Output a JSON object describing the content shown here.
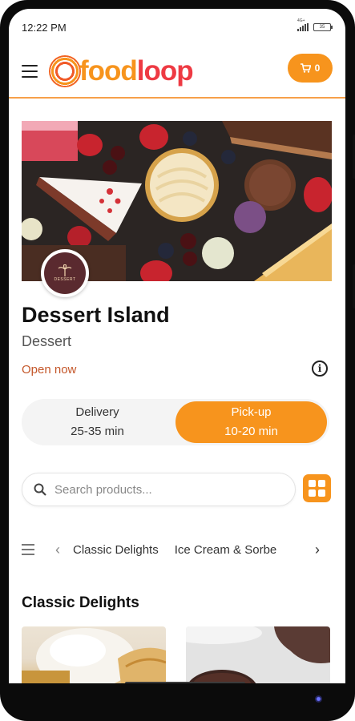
{
  "status_bar": {
    "time": "12:22 PM",
    "network": "4G+",
    "battery": "35"
  },
  "header": {
    "logo_prefix": "food",
    "logo_suffix": "loop",
    "cart_count": "0"
  },
  "store": {
    "logo_text": "DESSERT",
    "name": "Dessert Island",
    "category": "Dessert",
    "status": "Open now"
  },
  "fulfillment": {
    "options": [
      {
        "label": "Delivery",
        "time": "25-35 min",
        "selected": false
      },
      {
        "label": "Pick-up",
        "time": "10-20 min",
        "selected": true
      }
    ]
  },
  "search": {
    "placeholder": "Search products..."
  },
  "categories": {
    "tabs": [
      "Classic Delights",
      "Ice Cream & Sorbe"
    ]
  },
  "section": {
    "title": "Classic Delights"
  },
  "icons": {
    "menu": "menu-icon",
    "cart": "cart-icon",
    "info": "info-icon",
    "search": "search-icon",
    "grid": "grid-icon",
    "list": "list-icon",
    "prev": "chevron-left-icon",
    "next": "chevron-right-icon"
  },
  "colors": {
    "accent": "#f7941d",
    "logo_red": "#ee3a43",
    "status_open": "#c4572a"
  }
}
